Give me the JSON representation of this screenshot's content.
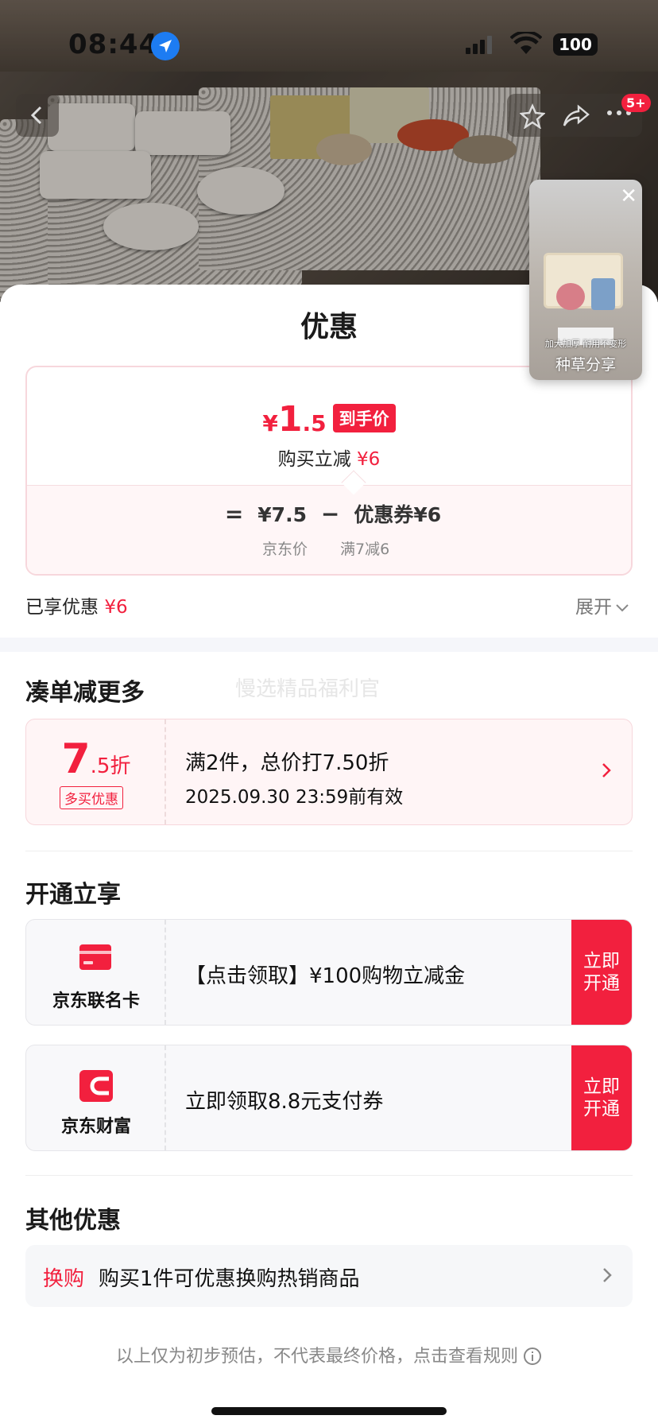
{
  "status_bar": {
    "time": "08:44",
    "battery": "100"
  },
  "nav": {
    "notification_badge": "5+"
  },
  "mini_player": {
    "subtitle": "加大加厚 耐用不变形",
    "label": "种草分享"
  },
  "sheet": {
    "title": "优惠"
  },
  "price_card": {
    "currency": "¥",
    "price_int": "1",
    "price_dec": ".5",
    "price_tag": "到手价",
    "instant_label": "购买立减",
    "instant_amount": "¥6",
    "eq": "=",
    "jd_price": "¥7.5",
    "minus": "−",
    "coupon_text": "优惠券¥6",
    "jd_price_label": "京东价",
    "coupon_rule": "满7减6"
  },
  "summary": {
    "enjoyed_label": "已享优惠",
    "enjoyed_amount": "¥6",
    "expand": "展开"
  },
  "bundle": {
    "title": "凑单减更多",
    "watermark": "慢选精品福利官",
    "discount_big": "7",
    "discount_small": ".5",
    "discount_unit": "折",
    "tag": "多买优惠",
    "desc": "满2件，总价打7.50折",
    "valid": "2025.09.30 23:59前有效"
  },
  "open_section": {
    "title": "开通立享",
    "items": [
      {
        "name": "京东联名卡",
        "desc": "【点击领取】¥100购物立减金",
        "cta_line1": "立即",
        "cta_line2": "开通"
      },
      {
        "name": "京东财富",
        "desc": "立即领取8.8元支付券",
        "cta_line1": "立即",
        "cta_line2": "开通"
      }
    ]
  },
  "other": {
    "title": "其他优惠",
    "tag": "换购",
    "desc": "购买1件可优惠换购热销商品"
  },
  "footer": {
    "note": "以上仅为初步预估，不代表最终价格，点击查看规则"
  },
  "colors": {
    "accent": "#f2203e",
    "pink_bg": "#fff5f6",
    "gray_bg": "#f8f8fa"
  }
}
